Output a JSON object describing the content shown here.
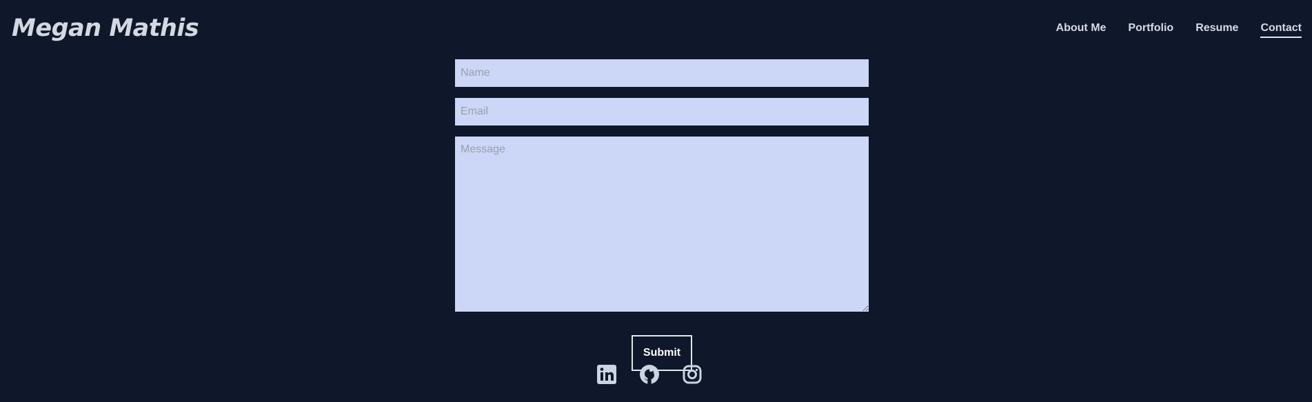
{
  "brand": {
    "name": "Megan Mathis"
  },
  "nav": {
    "items": [
      {
        "label": "About Me",
        "active": false
      },
      {
        "label": "Portfolio",
        "active": false
      },
      {
        "label": "Resume",
        "active": false
      },
      {
        "label": "Contact",
        "active": true
      }
    ]
  },
  "form": {
    "name_placeholder": "Name",
    "name_value": "",
    "email_placeholder": "Email",
    "email_value": "",
    "message_placeholder": "Message",
    "message_value": "",
    "submit_label": "Submit"
  },
  "social": {
    "items": [
      {
        "icon": "linkedin-icon"
      },
      {
        "icon": "github-icon"
      },
      {
        "icon": "instagram-icon"
      }
    ]
  },
  "colors": {
    "background": "#0f172a",
    "field_background": "#ccd6f6",
    "text": "#cbd5e1"
  }
}
